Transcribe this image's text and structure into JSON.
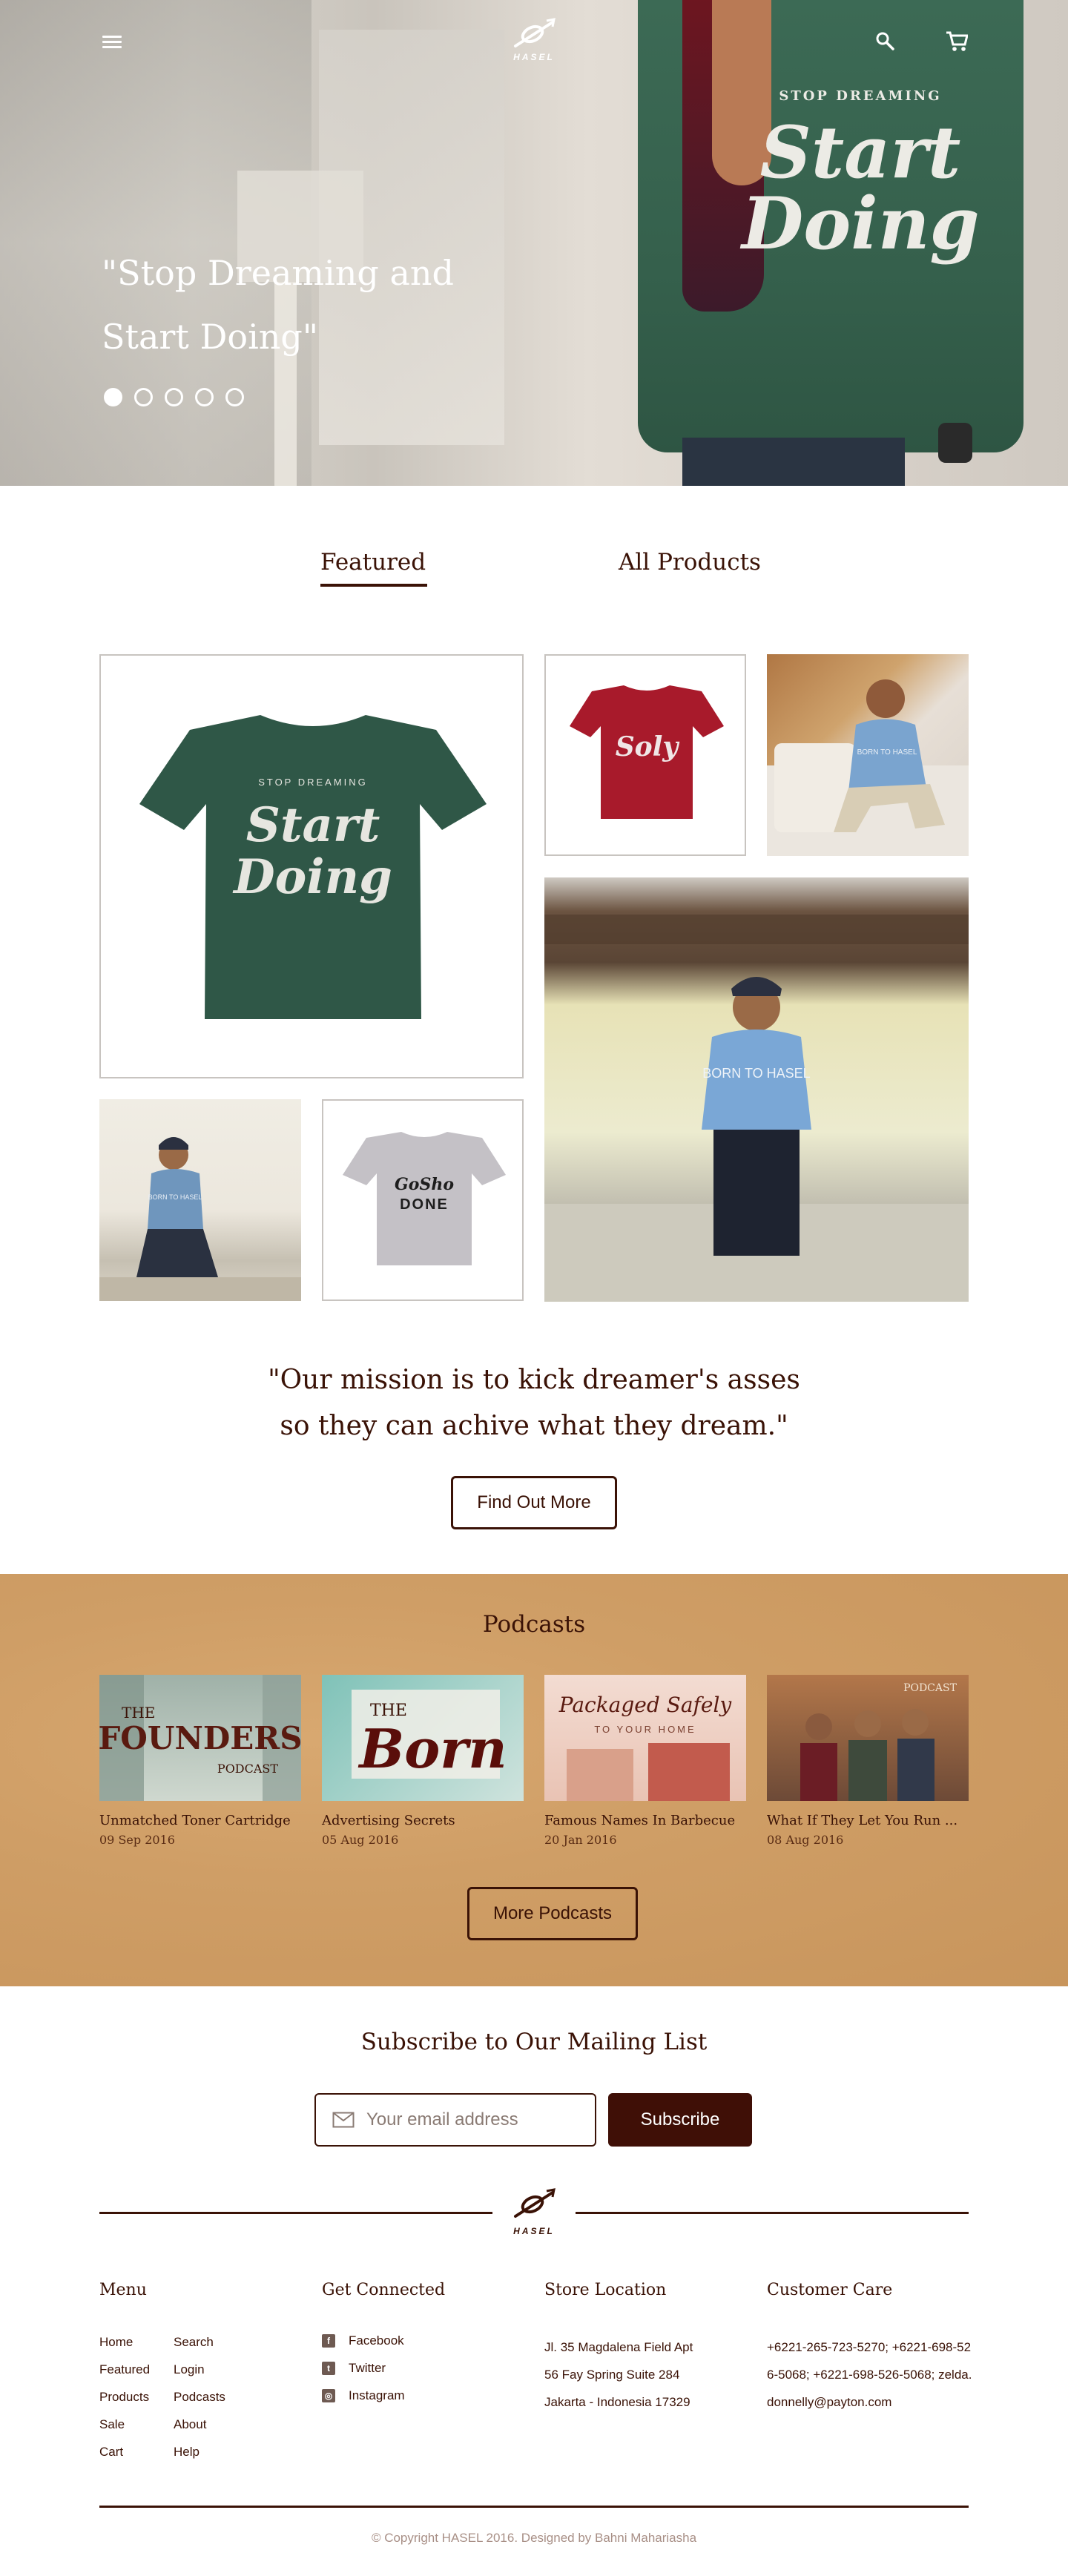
{
  "brand": {
    "name": "HASEL"
  },
  "hero": {
    "quote_line1": "\"Stop Dreaming and",
    "quote_line2": "Start Doing\"",
    "shirt_top": "STOP DREAMING",
    "shirt_main1": "Start",
    "shirt_main2": "Doing",
    "slides_total": 5,
    "active_slide": 1
  },
  "tabs": [
    {
      "label": "Featured",
      "active": true
    },
    {
      "label": "All Products",
      "active": false
    }
  ],
  "products": {
    "big_tee": {
      "top": "STOP DREAMING",
      "line1": "Start",
      "line2": "Doing",
      "color": "#2f5747"
    },
    "red_tee": {
      "line1": "Soly",
      "color": "#a81a2b"
    },
    "grey_tee": {
      "line1": "GoSho",
      "line2": "DONE",
      "color": "#c4c1c6"
    },
    "model_shirt_text": "BORN TO HASEL"
  },
  "mission": {
    "line1": "\"Our mission is to kick dreamer's asses",
    "line2": "so they can achive what they dream.\"",
    "button": "Find Out More"
  },
  "podcasts": {
    "heading": "Podcasts",
    "items": [
      {
        "title": "Unmatched Toner Cartridge",
        "date": "09 Sep 2016",
        "art_text": "FOUNDERS",
        "art_small1": "THE",
        "art_small2": "PODCAST"
      },
      {
        "title": "Advertising Secrets",
        "date": "05 Aug 2016",
        "art_text": "Born",
        "art_small1": "THE"
      },
      {
        "title": "Famous Names In Barbecue",
        "date": "20 Jan 2016",
        "art_text": "Packaged Safely",
        "art_small1": "TO YOUR HOME"
      },
      {
        "title": "What If They Let You Run ...",
        "date": "08 Aug 2016",
        "art_small1": "PODCAST"
      }
    ],
    "button": "More Podcasts"
  },
  "subscribe": {
    "title": "Subscribe to Our Mailing List",
    "placeholder": "Your email address",
    "button": "Subscribe"
  },
  "footer": {
    "menu_title": "Menu",
    "menu_col1": [
      "Home",
      "Featured",
      "Products",
      "Sale",
      "Cart"
    ],
    "menu_col2": [
      "Search",
      "Login",
      "Podcasts",
      "About",
      "Help"
    ],
    "connect_title": "Get Connected",
    "social": [
      {
        "label": "Facebook",
        "icon": "facebook-icon"
      },
      {
        "label": "Twitter",
        "icon": "twitter-icon"
      },
      {
        "label": "Instagram",
        "icon": "instagram-icon"
      }
    ],
    "store_title": "Store Location",
    "address": [
      "Jl. 35 Magdalena Field Apt",
      "56 Fay Spring Suite 284",
      "Jakarta - Indonesia 17329"
    ],
    "care_title": "Customer Care",
    "care_text": "+6221-265-723-5270; +6221-698-526-5068; +6221-698-526-5068; zelda.donnelly@payton.com",
    "copyright": "© Copyright HASEL 2016. Designed by Bahni Mahariasha"
  },
  "colors": {
    "brand_dark": "#3a1206",
    "podcast_bg": "#cf9e66",
    "subscribe_btn": "#3f0f06"
  }
}
